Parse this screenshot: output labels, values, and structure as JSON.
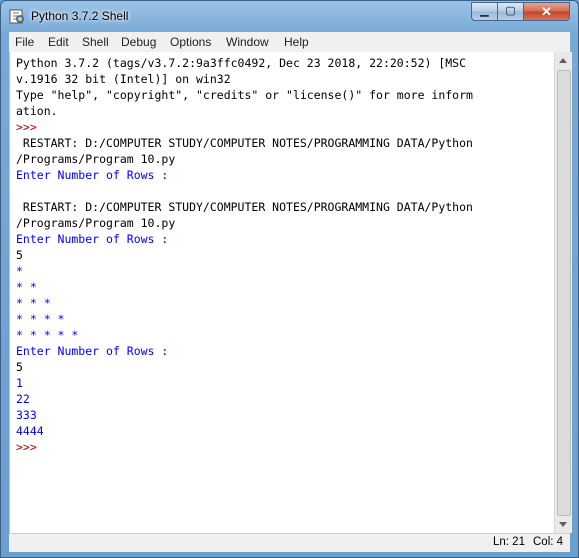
{
  "window": {
    "title": "Python 3.7.2 Shell"
  },
  "window_controls": {
    "minimize": "▁",
    "maximize": "▢",
    "close": "✕"
  },
  "menu": [
    "File",
    "Edit",
    "Shell",
    "Debug",
    "Options",
    "Window",
    "Help"
  ],
  "colors": {
    "output_blue": "#0000ff",
    "prompt_red": "#c00000",
    "default": "#000000"
  },
  "lines": [
    {
      "text": "Python 3.7.2 (tags/v3.7.2:9a3ffc0492, Dec 23 2018, 22:20:52) [MSC",
      "color": "#000000"
    },
    {
      "text": "v.1916 32 bit (Intel)] on win32",
      "color": "#000000"
    },
    {
      "text": "Type \"help\", \"copyright\", \"credits\" or \"license()\" for more inform",
      "color": "#000000"
    },
    {
      "text": "ation.",
      "color": "#000000"
    },
    {
      "text": ">>>",
      "color": "#c00000"
    },
    {
      "text": " RESTART: D:/COMPUTER STUDY/COMPUTER NOTES/PROGRAMMING DATA/Python",
      "color": "#000000"
    },
    {
      "text": "/Programs/Program 10.py",
      "color": "#000000"
    },
    {
      "text": "Enter Number of Rows :",
      "color": "#0000ff"
    },
    {
      "text": "",
      "color": "#000000"
    },
    {
      "text": " RESTART: D:/COMPUTER STUDY/COMPUTER NOTES/PROGRAMMING DATA/Python",
      "color": "#000000"
    },
    {
      "text": "/Programs/Program 10.py",
      "color": "#000000"
    },
    {
      "text": "Enter Number of Rows :",
      "color": "#0000ff"
    },
    {
      "text": "5",
      "color": "#000000"
    },
    {
      "text": "*",
      "color": "#0000ff"
    },
    {
      "text": "* *",
      "color": "#0000ff"
    },
    {
      "text": "* * *",
      "color": "#0000ff"
    },
    {
      "text": "* * * *",
      "color": "#0000ff"
    },
    {
      "text": "* * * * *",
      "color": "#0000ff"
    },
    {
      "text": "Enter Number of Rows :",
      "color": "#0000ff"
    },
    {
      "text": "5",
      "color": "#000000"
    },
    {
      "text": "1",
      "color": "#0000ff"
    },
    {
      "text": "22",
      "color": "#0000ff"
    },
    {
      "text": "333",
      "color": "#0000ff"
    },
    {
      "text": "4444",
      "color": "#0000ff"
    },
    {
      "text": ">>>",
      "color": "#c00000"
    }
  ],
  "status": {
    "line": "Ln: 21",
    "col": "Col: 4"
  }
}
